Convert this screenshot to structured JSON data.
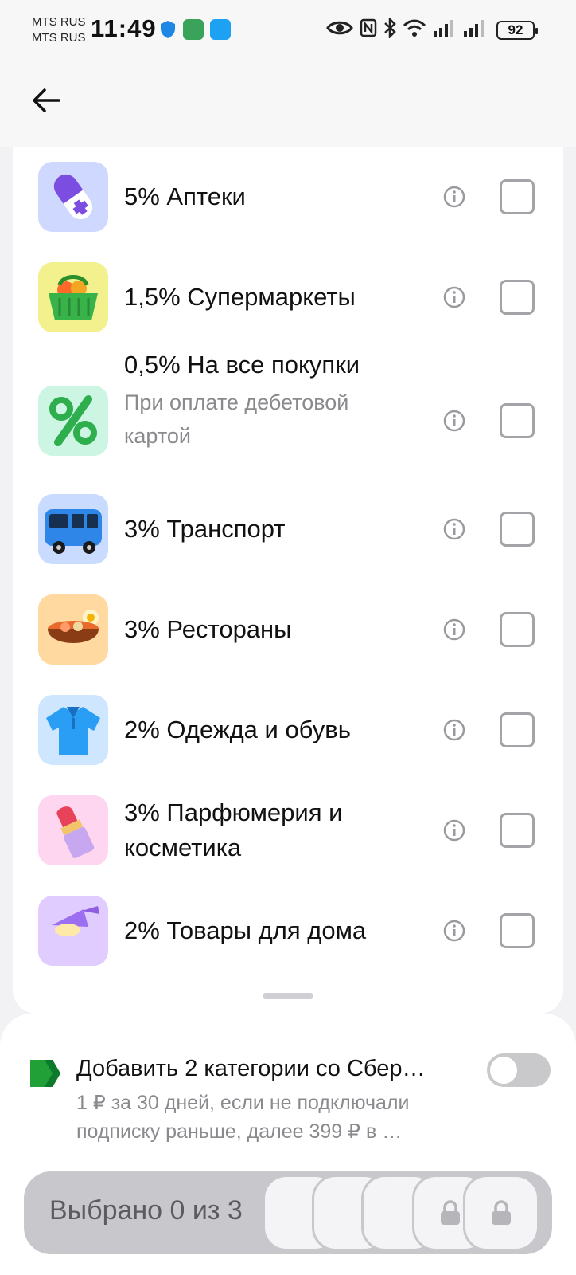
{
  "status_bar": {
    "carrier_1": "MTS RUS",
    "carrier_2": "MTS RUS",
    "time": "11:49",
    "battery": "92"
  },
  "colors": {
    "accent_green": "#21a038",
    "checkbox_border": "#a4a4a8",
    "toggle_off": "#c9c9cc",
    "select_bar_bg": "#c8c8cc"
  },
  "categories": [
    {
      "title": "5% Аптеки",
      "subtitle": "",
      "icon": "pill-icon",
      "checked": false
    },
    {
      "title": "1,5% Супермаркеты",
      "subtitle": "",
      "icon": "grocery-basket-icon",
      "checked": false
    },
    {
      "title": "0,5% На все покупки",
      "subtitle": "При оплате дебетовой картой",
      "icon": "percent-icon",
      "checked": false
    },
    {
      "title": "3% Транспорт",
      "subtitle": "",
      "icon": "bus-icon",
      "checked": false
    },
    {
      "title": "3% Рестораны",
      "subtitle": "",
      "icon": "soup-bowl-icon",
      "checked": false
    },
    {
      "title": "2% Одежда и обувь",
      "subtitle": "",
      "icon": "polo-shirt-icon",
      "checked": false
    },
    {
      "title": "3% Парфюмерия и косметика",
      "subtitle": "",
      "icon": "lipstick-icon",
      "checked": false
    },
    {
      "title": "2% Товары для дома",
      "subtitle": "",
      "icon": "desk-lamp-icon",
      "checked": false
    }
  ],
  "promo": {
    "title": "Добавить 2 категории со Сбер…",
    "desc_line_1": "1 ₽ за 30 дней, если не подключали",
    "desc_line_2": "подписку раньше, далее 399 ₽ в …",
    "toggle_on": false
  },
  "selection": {
    "label": "Выбрано 0 из 3",
    "selected": 0,
    "max": 3
  }
}
